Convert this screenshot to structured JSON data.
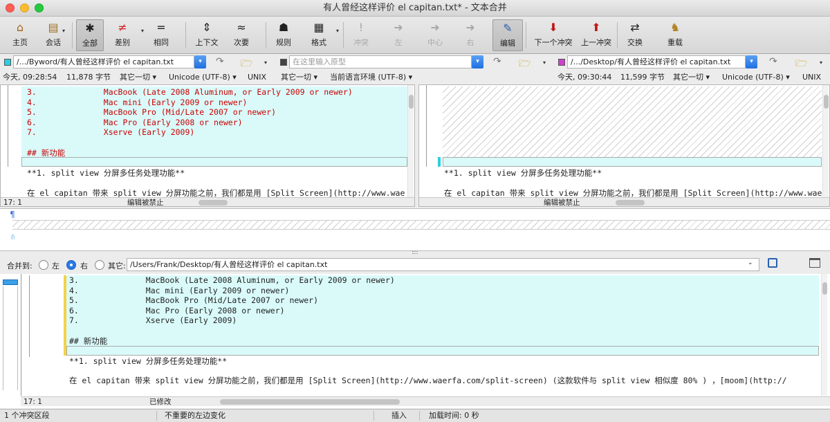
{
  "window": {
    "title": "有人曾经这样评价 el capitan.txt* - 文本合并"
  },
  "toolbar": [
    {
      "label": "主页",
      "icon": "home-icon",
      "glyph": "⌂",
      "state": "normal"
    },
    {
      "label": "会话",
      "icon": "briefcase-icon",
      "glyph": "▤",
      "state": "normal"
    },
    {
      "label": "全部",
      "icon": "asterisk-icon",
      "glyph": "✱",
      "state": "active"
    },
    {
      "label": "差别",
      "icon": "not-equal-icon",
      "glyph": "≠",
      "state": "normal"
    },
    {
      "label": "相同",
      "icon": "equal-icon",
      "glyph": "=",
      "state": "normal"
    },
    {
      "label": "上下文",
      "icon": "context-icon",
      "glyph": "⇕",
      "state": "normal"
    },
    {
      "label": "次要",
      "icon": "approx-icon",
      "glyph": "≈",
      "state": "normal"
    },
    {
      "label": "规则",
      "icon": "rules-person-icon",
      "glyph": "☗",
      "state": "normal"
    },
    {
      "label": "格式",
      "icon": "format-icon",
      "glyph": "▦",
      "state": "normal"
    },
    {
      "label": "冲突",
      "icon": "conflict-icon",
      "glyph": "!",
      "state": "disabled"
    },
    {
      "label": "左",
      "icon": "left-arrow-icon",
      "glyph": "➜",
      "state": "disabled"
    },
    {
      "label": "中心",
      "icon": "center-arrow-icon",
      "glyph": "➜",
      "state": "disabled"
    },
    {
      "label": "右",
      "icon": "right-arrow-icon",
      "glyph": "➜",
      "state": "disabled"
    },
    {
      "label": "编辑",
      "icon": "edit-pen-icon",
      "glyph": "✎",
      "state": "active"
    },
    {
      "label": "下一个冲突",
      "icon": "next-conflict-icon",
      "glyph": "⬇",
      "state": "normal"
    },
    {
      "label": "上一冲突",
      "icon": "prev-conflict-icon",
      "glyph": "⬆",
      "state": "normal"
    },
    {
      "label": "交换",
      "icon": "swap-icon",
      "glyph": "⇄",
      "state": "normal"
    },
    {
      "label": "重载",
      "icon": "reload-icon",
      "glyph": "♞",
      "state": "normal"
    }
  ],
  "colors": {
    "accent": "#1f6fe0",
    "diff_highlight": "#dafafa",
    "red_text": "#cc0000",
    "left_marker": "#2ad0e0",
    "right_marker": "#d040d0"
  },
  "left": {
    "path": "/.../Byword/有人曾经这样评价 el capitan.txt",
    "time": "今天, 09:28:54",
    "size": "11,878 字节",
    "misc": "其它一切 ▾",
    "encoding": "Unicode (UTF-8) ▾",
    "eol": "UNIX",
    "status_pos": "17: 1",
    "status_msg": "编辑被禁止"
  },
  "middle": {
    "placeholder": "在这里输入原型",
    "misc": "其它一切 ▾",
    "locale": "当前语言环境 (UTF-8) ▾"
  },
  "right": {
    "path": "/.../Desktop/有人曾经这样评价 el capitan.txt",
    "time": "今天, 09:30:44",
    "size": "11,599 字节",
    "misc": "其它一切 ▾",
    "encoding": "Unicode (UTF-8) ▾",
    "eol": "UNIX",
    "status_pos": "",
    "status_msg": "编辑被禁止"
  },
  "left_lines": [
    {
      "num": "3.",
      "text": "MacBook (Late 2008 Aluminum, or Early 2009 or newer)"
    },
    {
      "num": "4.",
      "text": "Mac mini (Early 2009 or newer)"
    },
    {
      "num": "5.",
      "text": "MacBook Pro (Mid/Late 2007 or newer)"
    },
    {
      "num": "6.",
      "text": "Mac Pro (Early 2008 or newer)"
    },
    {
      "num": "7.",
      "text": "Xserve (Early 2009)"
    }
  ],
  "heading": "## 新功能",
  "split_view_line": "**1. split view 分屏多任务处理功能**",
  "long_line": "在 el capitan 带来 split view 分屏功能之前，我们都是用 [Split Screen](http://www.waerfa.com/split-screen) (这款软件与 split view 相似度 80% ) ，[moom](http://",
  "merge": {
    "label": "合并到:",
    "opt_left": "左",
    "opt_right": "右",
    "opt_other": "其它:",
    "path": "/Users/Frank/Desktop/有人曾经这样评价 el capitan.txt"
  },
  "output": {
    "status_pos": "17: 1",
    "status_msg": "已修改"
  },
  "pilcrow": "¶",
  "bottom": {
    "conflicts": "1 个冲突区段",
    "changes": "不重要的左边变化",
    "mode": "插入",
    "load": "加载时间: 0 秒"
  }
}
